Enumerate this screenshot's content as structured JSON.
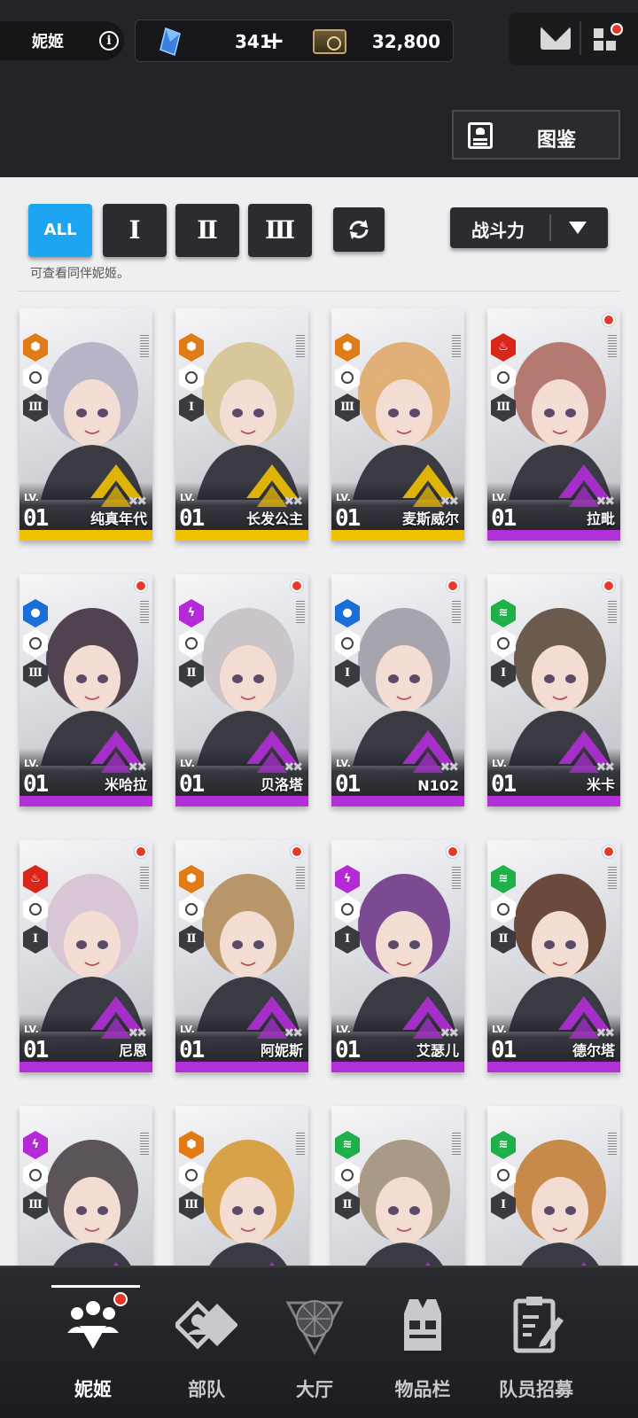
{
  "topbar": {
    "user_name": "妮姬",
    "info_icon": "info-icon",
    "gem_count": "341",
    "gem_plus": "+",
    "credit_count": "32,800",
    "codex_label": "图鉴"
  },
  "filters": {
    "all_label": "ALL",
    "burst_1": "Ⅰ",
    "burst_2": "Ⅱ",
    "burst_3": "Ⅲ",
    "sort_label": "战斗力",
    "hint": "可查看同伴妮姬。"
  },
  "colors": {
    "accent_blue": "#1ea5f2",
    "ssr_gold": "#f2c200",
    "sr_purple": "#b22fd9",
    "badge_red": "#e3372a",
    "elem_iron": "#e07b16",
    "elem_fire": "#d8261b",
    "elem_water": "#1a6ed8",
    "elem_electric": "#b32ad6",
    "elem_wind": "#1fb04a"
  },
  "cards": [
    {
      "name": "纯真年代",
      "lv_label": "LV.",
      "level": "01",
      "rarity": "ssr",
      "element": "iron",
      "burst": "Ⅲ",
      "new": false
    },
    {
      "name": "长发公主",
      "lv_label": "LV.",
      "level": "01",
      "rarity": "ssr",
      "element": "iron",
      "burst": "Ⅰ",
      "new": false
    },
    {
      "name": "麦斯威尔",
      "lv_label": "LV.",
      "level": "01",
      "rarity": "ssr",
      "element": "iron",
      "burst": "Ⅲ",
      "new": false
    },
    {
      "name": "拉毗",
      "lv_label": "LV.",
      "level": "01",
      "rarity": "sr",
      "element": "fire",
      "burst": "Ⅲ",
      "new": true
    },
    {
      "name": "米哈拉",
      "lv_label": "LV.",
      "level": "01",
      "rarity": "sr",
      "element": "water",
      "burst": "Ⅲ",
      "new": true
    },
    {
      "name": "贝洛塔",
      "lv_label": "LV.",
      "level": "01",
      "rarity": "sr",
      "element": "electric",
      "burst": "Ⅱ",
      "new": true
    },
    {
      "name": "N102",
      "lv_label": "LV.",
      "level": "01",
      "rarity": "sr",
      "element": "water",
      "burst": "Ⅰ",
      "new": true
    },
    {
      "name": "米卡",
      "lv_label": "LV.",
      "level": "01",
      "rarity": "sr",
      "element": "wind",
      "burst": "Ⅰ",
      "new": true
    },
    {
      "name": "尼恩",
      "lv_label": "LV.",
      "level": "01",
      "rarity": "sr",
      "element": "fire",
      "burst": "Ⅰ",
      "new": true
    },
    {
      "name": "阿妮斯",
      "lv_label": "LV.",
      "level": "01",
      "rarity": "sr",
      "element": "iron",
      "burst": "Ⅱ",
      "new": true
    },
    {
      "name": "艾瑟儿",
      "lv_label": "LV.",
      "level": "01",
      "rarity": "sr",
      "element": "electric",
      "burst": "Ⅰ",
      "new": true
    },
    {
      "name": "德尔塔",
      "lv_label": "LV.",
      "level": "01",
      "rarity": "sr",
      "element": "wind",
      "burst": "Ⅱ",
      "new": true
    },
    {
      "name": "",
      "lv_label": "",
      "level": "",
      "rarity": "sr",
      "element": "electric",
      "burst": "Ⅲ",
      "new": false
    },
    {
      "name": "",
      "lv_label": "",
      "level": "",
      "rarity": "sr",
      "element": "iron",
      "burst": "Ⅲ",
      "new": false
    },
    {
      "name": "",
      "lv_label": "",
      "level": "",
      "rarity": "sr",
      "element": "wind",
      "burst": "Ⅱ",
      "new": false
    },
    {
      "name": "",
      "lv_label": "",
      "level": "",
      "rarity": "sr",
      "element": "wind",
      "burst": "Ⅰ",
      "new": false
    }
  ],
  "nav": {
    "items": [
      {
        "label": "妮姬",
        "icon": "nikke-people-icon",
        "active": true
      },
      {
        "label": "部队",
        "icon": "squad-icon",
        "active": false
      },
      {
        "label": "大厅",
        "icon": "lobby-icon",
        "active": false
      },
      {
        "label": "物品栏",
        "icon": "inventory-vest-icon",
        "active": false
      },
      {
        "label": "队员招募",
        "icon": "recruit-clipboard-icon",
        "active": false
      }
    ]
  }
}
